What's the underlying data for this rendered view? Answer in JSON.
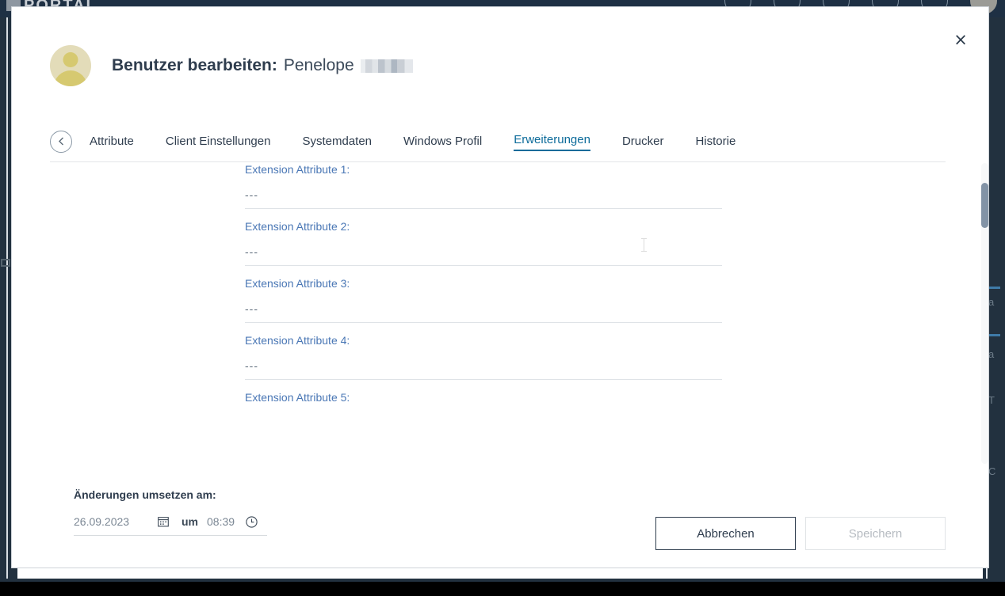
{
  "background": {
    "brand": "PORTAL",
    "header_icons": [
      "user-icon",
      "info-icon",
      "grid-icon",
      "help-icon",
      "globe-icon",
      "account-icon"
    ]
  },
  "modal": {
    "close_label": "×",
    "title": "Benutzer bearbeiten:",
    "person_name": "Penelope",
    "person_name_redacted": true,
    "avatar": "user-avatar",
    "tabs": {
      "back_button": "previous-tabs",
      "items": [
        {
          "label": "Attribute",
          "active": false,
          "clipped": true
        },
        {
          "label": "Client Einstellungen",
          "active": false,
          "clipped": false
        },
        {
          "label": "Systemdaten",
          "active": false,
          "clipped": false
        },
        {
          "label": "Windows Profil",
          "active": false,
          "clipped": false
        },
        {
          "label": "Erweiterungen",
          "active": true,
          "clipped": false
        },
        {
          "label": "Drucker",
          "active": false,
          "clipped": false
        },
        {
          "label": "Historie",
          "active": false,
          "clipped": false
        }
      ]
    },
    "fields": [
      {
        "label": "Extension Attribute 1:",
        "value": "---"
      },
      {
        "label": "Extension Attribute 2:",
        "value": "---"
      },
      {
        "label": "Extension Attribute 3:",
        "value": "---"
      },
      {
        "label": "Extension Attribute 4:",
        "value": "---"
      },
      {
        "label": "Extension Attribute 5:",
        "value": ""
      }
    ],
    "footer": {
      "schedule_label": "Änderungen umsetzen am:",
      "date_value": "26.09.2023",
      "date_icon": "calendar-icon",
      "separator_label": "um",
      "time_value": "08:39",
      "time_icon": "clock-icon",
      "cancel_label": "Abbrechen",
      "save_label": "Speichern",
      "save_disabled": true
    }
  },
  "colors": {
    "accent": "#0c6b9a",
    "label_blue": "#4a77b5",
    "dark_navy": "#2f3d4e",
    "header_bg": "#1e3044",
    "scrollbar_thumb": "#8293a6"
  }
}
